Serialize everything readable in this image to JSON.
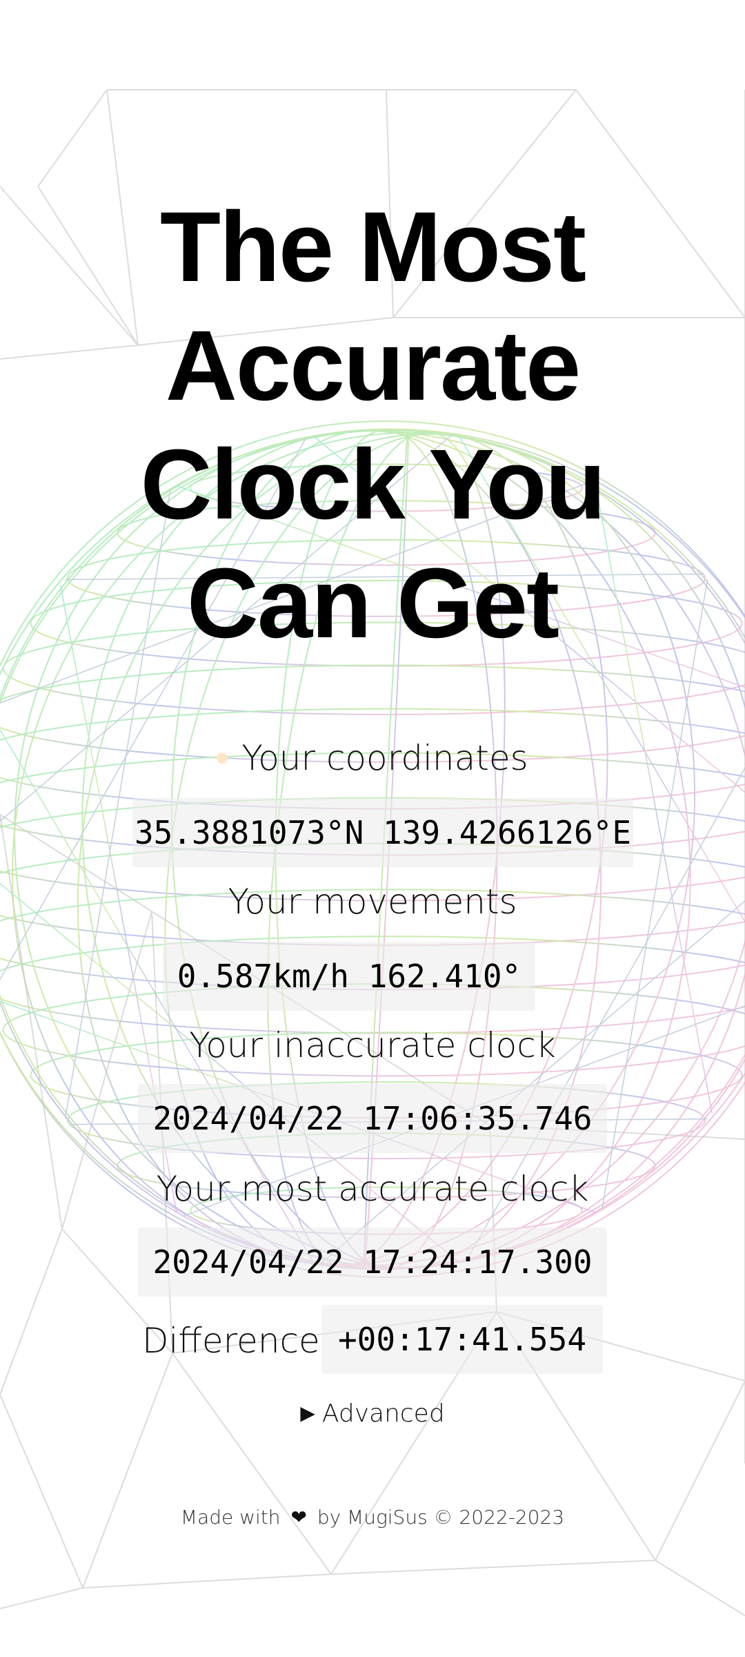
{
  "page": {
    "title_lines": [
      "The Most",
      "Accurate",
      "Clock You",
      "Can Get"
    ]
  },
  "coordinates": {
    "label": "Your coordinates",
    "value": "35.3881073°N 139.4266126°E",
    "status_dot_color": "#fde6c8"
  },
  "movements": {
    "label": "Your movements",
    "value": "0.587km/h 162.410°"
  },
  "inaccurate_clock": {
    "label": "Your inaccurate clock",
    "value": "2024/04/22 17:06:35.746"
  },
  "accurate_clock": {
    "label": "Your most accurate clock",
    "value": "2024/04/22 17:24:17.300"
  },
  "difference": {
    "label": "Difference",
    "value": "+00:17:41.554"
  },
  "advanced": {
    "label": "Advanced",
    "icon": "triangle-right-icon"
  },
  "footer": {
    "prefix": "Made with",
    "icon": "heart-icon",
    "suffix": "by MugiSus © 2022-2023"
  }
}
